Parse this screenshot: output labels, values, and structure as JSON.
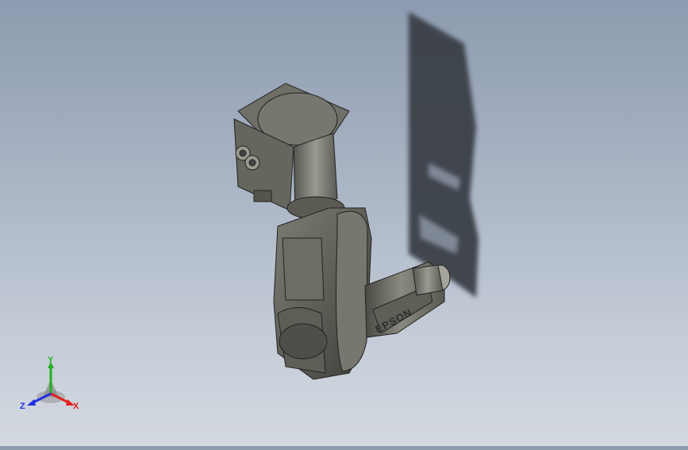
{
  "viewport": {
    "model": {
      "brand_marking": "EPSON"
    },
    "triad": {
      "x_label": "X",
      "y_label": "Y",
      "z_label": "Z",
      "x_color": "#e02020",
      "y_color": "#20b020",
      "z_color": "#2030e0"
    }
  }
}
